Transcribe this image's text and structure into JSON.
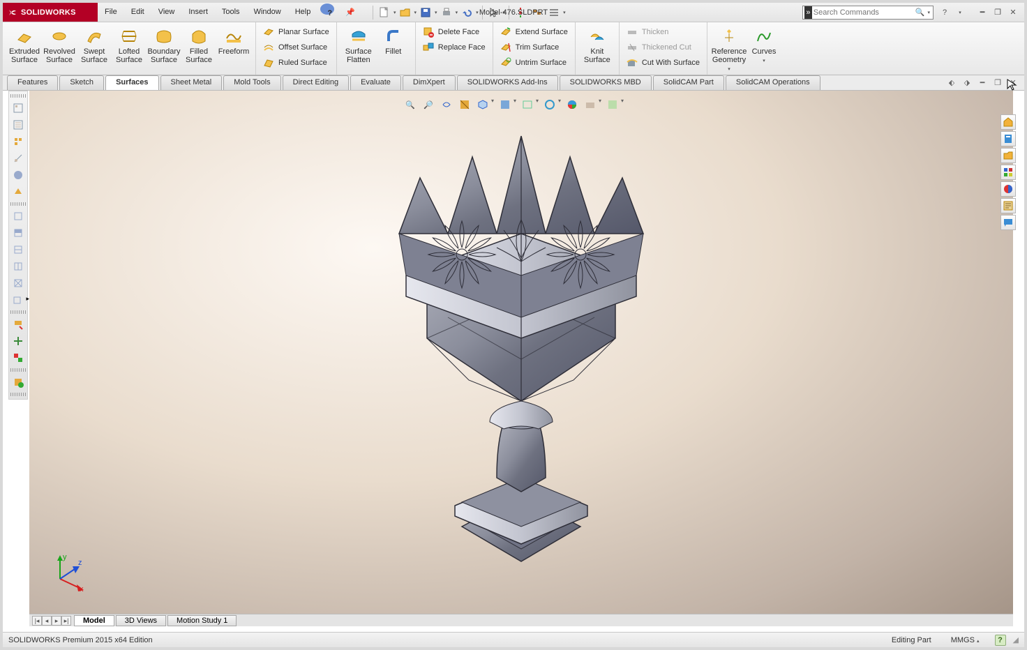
{
  "app": {
    "name": "SOLIDWORKS",
    "filename": "Model-476.SLDPRT"
  },
  "menu": [
    "File",
    "Edit",
    "View",
    "Insert",
    "Tools",
    "Window",
    "Help"
  ],
  "search": {
    "placeholder": "Search Commands"
  },
  "ribbon": {
    "group1": [
      {
        "label": "Extruded Surface"
      },
      {
        "label": "Revolved Surface"
      },
      {
        "label": "Swept Surface"
      },
      {
        "label": "Lofted Surface"
      },
      {
        "label": "Boundary Surface"
      },
      {
        "label": "Filled Surface"
      },
      {
        "label": "Freeform"
      }
    ],
    "group2": [
      "Planar Surface",
      "Offset Surface",
      "Ruled Surface"
    ],
    "group3": {
      "big": "Surface Flatten",
      "side": "Fillet"
    },
    "group4": [
      "Delete Face",
      "Replace Face"
    ],
    "group5": [
      "Extend Surface",
      "Trim Surface",
      "Untrim Surface"
    ],
    "group6": {
      "big": "Knit Surface"
    },
    "group7": [
      "Thicken",
      "Thickened Cut",
      "Cut With Surface"
    ],
    "group8": [
      {
        "label": "Reference Geometry"
      },
      {
        "label": "Curves"
      }
    ]
  },
  "cmtabs": [
    "Features",
    "Sketch",
    "Surfaces",
    "Sheet Metal",
    "Mold Tools",
    "Direct Editing",
    "Evaluate",
    "DimXpert",
    "SOLIDWORKS Add-Ins",
    "SOLIDWORKS MBD",
    "SolidCAM Part",
    "SolidCAM Operations"
  ],
  "cmtabs_active": 2,
  "motiontabs": [
    "Model",
    "3D Views",
    "Motion Study 1"
  ],
  "status": {
    "edition": "SOLIDWORKS Premium 2015 x64 Edition",
    "mode": "Editing Part",
    "units": "MMGS"
  }
}
